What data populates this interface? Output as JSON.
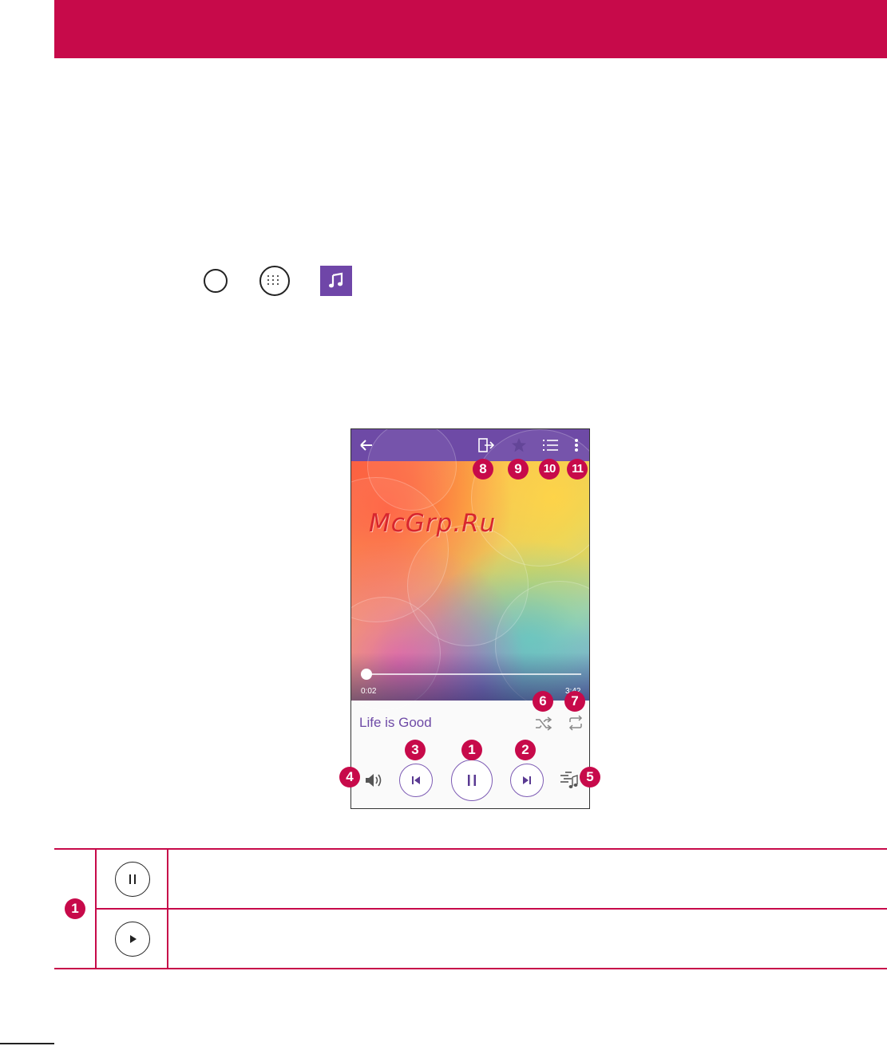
{
  "player": {
    "song_title": "Life is Good",
    "elapsed_time": "0:02",
    "total_time": "3:42",
    "progress": 0.0,
    "watermark": "McGrp.Ru"
  },
  "callouts": {
    "play_pause": "1",
    "next": "2",
    "previous": "3",
    "volume": "4",
    "equalizer": "5",
    "shuffle": "6",
    "repeat": "7",
    "share": "8",
    "favorite": "9",
    "playlist": "10",
    "more": "11"
  },
  "table": {
    "row_callout": "1",
    "rows": [
      {
        "icon": "pause-icon",
        "description": ""
      },
      {
        "icon": "play-icon",
        "description": ""
      }
    ]
  },
  "icons": [
    "back-arrow-icon",
    "share-icon",
    "star-icon",
    "list-icon",
    "more-vert-icon",
    "shuffle-icon",
    "repeat-icon",
    "volume-icon",
    "equalizer-icon",
    "home-icon",
    "apps-icon",
    "music-note-icon"
  ],
  "colors": {
    "accent": "#c70a4a",
    "player_purple": "#6e4aa6"
  }
}
